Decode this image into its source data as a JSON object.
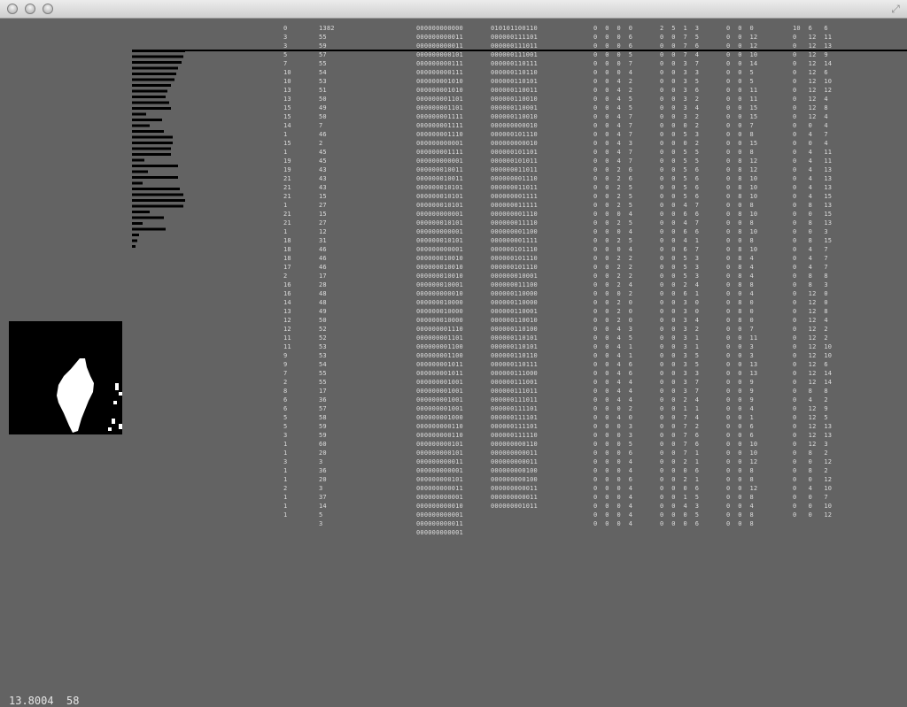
{
  "window": {
    "title": ""
  },
  "col_a": [
    "0",
    "3",
    "3",
    "5",
    "7",
    "10",
    "10",
    "13",
    "13",
    "15",
    "15",
    "14",
    "1",
    "15",
    "1",
    "19",
    "19",
    "21",
    "21",
    "21",
    "1",
    "21",
    "21",
    "1",
    "18",
    "18",
    "18",
    "17",
    "2",
    "16",
    "16",
    "14",
    "13",
    "12",
    "12",
    "11",
    "11",
    "9",
    "9",
    "7",
    "2",
    "8",
    "6",
    "6",
    "5",
    "5",
    "3",
    "1",
    "1",
    "3",
    "1",
    "1",
    "2",
    "1",
    "1",
    "1"
  ],
  "col_b": [
    "1382",
    "55",
    "59",
    "57",
    "55",
    "54",
    "53",
    "51",
    "50",
    "49",
    "50",
    "7",
    "46",
    "2",
    "45",
    "45",
    "43",
    "43",
    "43",
    "15",
    "27",
    "15",
    "27",
    "12",
    "31",
    "46",
    "46",
    "46",
    "17",
    "28",
    "48",
    "48",
    "49",
    "50",
    "52",
    "52",
    "53",
    "53",
    "54",
    "55",
    "55",
    "17",
    "36",
    "57",
    "58",
    "59",
    "59",
    "60",
    "20",
    "3",
    "36",
    "20",
    "3",
    "37",
    "14",
    "5",
    "3"
  ],
  "col_c": [
    "000000000000",
    "000000000011",
    "000000000011",
    "000000000101",
    "000000000111",
    "000000000111",
    "000000001010",
    "000000001010",
    "000000001101",
    "000000001101",
    "000000001111",
    "000000001111",
    "000000001110",
    "000000000001",
    "000000001111",
    "000000000001",
    "000000010011",
    "000000010011",
    "000000010101",
    "000000010101",
    "000000010101",
    "000000000001",
    "000000010101",
    "000000000001",
    "000000010101",
    "000000000001",
    "000000010010",
    "000000010010",
    "000000010010",
    "000000010001",
    "000000000010",
    "000000010000",
    "000000010000",
    "000000010000",
    "000000001110",
    "000000001101",
    "000000001100",
    "000000001100",
    "000000001011",
    "000000001011",
    "000000001001",
    "000000001001",
    "000000001001",
    "000000001001",
    "000000001000",
    "000000000110",
    "000000000110",
    "000000000101",
    "000000000101",
    "000000000011",
    "000000000001",
    "000000000101",
    "000000000011",
    "000000000001",
    "000000000010",
    "000000000001",
    "000000000011",
    "000000000001"
  ],
  "col_d": [
    "010101100110",
    "000000111101",
    "000000111011",
    "000000111001",
    "000000110111",
    "000000110110",
    "000000110101",
    "000000110011",
    "000000110010",
    "000000110001",
    "000000110010",
    "000000000010",
    "000000101110",
    "000000000010",
    "000000101101",
    "000000101011",
    "000000011011",
    "000000001110",
    "000000011011",
    "000000001111",
    "000000011111",
    "000000001110",
    "000000011110",
    "000000001100",
    "000000001111",
    "000000101110",
    "000000101110",
    "000000101110",
    "000000010001",
    "000000011100",
    "000000110000",
    "000000110000",
    "000000110001",
    "000000110010",
    "000000110100",
    "000000110101",
    "000000110101",
    "000000110110",
    "000000110111",
    "000000111000",
    "000000111001",
    "000000111011",
    "000000111011",
    "000000111101",
    "000000111101",
    "000000111101",
    "000000111110",
    "000000000110",
    "000000000011",
    "000000000011",
    "000000000100",
    "000000000100",
    "000000000011",
    "000000000011",
    "000000001011"
  ],
  "col_e": [
    "0  0  0  0",
    "0  0  0  6",
    "0  0  0  6",
    "0  0  0  5",
    "0  0  0  7",
    "0  0  0  4",
    "0  0  4  2",
    "0  0  4  2",
    "0  0  4  5",
    "0  0  4  5",
    "0  0  4  7",
    "0  0  4  7",
    "0  0  4  7",
    "0  0  4  3",
    "0  0  4  7",
    "0  0  4  7",
    "0  0  2  6",
    "0  0  2  6",
    "0  0  2  5",
    "0  0  2  5",
    "0  0  2  5",
    "0  0  0  4",
    "0  0  2  5",
    "0  0  0  4",
    "0  0  2  5",
    "0  0  0  4",
    "0  0  2  2",
    "0  0  2  2",
    "0  0  2  2",
    "0  0  2  4",
    "0  0  0  2",
    "0  0  2  0",
    "0  0  2  0",
    "0  0  2  0",
    "0  0  4  3",
    "0  0  4  5",
    "0  0  4  1",
    "0  0  4  1",
    "0  0  4  6",
    "0  0  4  6",
    "0  0  4  4",
    "0  0  4  4",
    "0  0  4  4",
    "0  0  0  2",
    "0  0  4  0",
    "0  0  0  3",
    "0  0  0  3",
    "0  0  0  5",
    "0  0  0  6",
    "0  0  0  4",
    "0  0  0  4",
    "0  0  0  6",
    "0  0  0  4",
    "0  0  0  4",
    "0  0  0  4",
    "0  0  0  4",
    "0  0  0  4"
  ],
  "col_f": [
    "2  5  1  3",
    "0  0  7  5",
    "0  0  7  6",
    "0  0  7  4",
    "0  0  3  7",
    "0  0  3  3",
    "0  0  3  5",
    "0  0  3  6",
    "0  0  3  2",
    "0  0  3  4",
    "0  0  3  2",
    "0  0  0  2",
    "0  0  5  3",
    "0  0  0  2",
    "0  0  5  5",
    "0  0  5  5",
    "0  0  5  6",
    "0  0  5  6",
    "0  0  5  6",
    "0  0  5  6",
    "0  0  4  7",
    "0  0  6  6",
    "0  0  4  7",
    "0  0  6  6",
    "0  0  4  1",
    "0  0  6  7",
    "0  0  5  3",
    "0  0  5  3",
    "0  0  5  3",
    "0  0  2  4",
    "0  0  6  1",
    "0  0  3  0",
    "0  0  3  0",
    "0  0  3  4",
    "0  0  3  2",
    "0  0  3  1",
    "0  0  3  1",
    "0  0  3  5",
    "0  0  3  5",
    "0  0  3  3",
    "0  0  3  7",
    "0  0  3  7",
    "0  0  2  4",
    "0  0  1  1",
    "0  0  7  4",
    "0  0  7  2",
    "0  0  7  6",
    "0  0  7  6",
    "0  0  7  1",
    "0  0  2  1",
    "0  0  0  6",
    "0  0  2  1",
    "0  0  0  6",
    "0  0  1  5",
    "0  0  4  3",
    "0  0  0  5",
    "0  0  0  6"
  ],
  "col_g": [
    "0  0  0",
    "0  0  12",
    "0  0  12",
    "0  0  10",
    "0  0  14",
    "0  0  5",
    "0  0  5",
    "0  0  11",
    "0  0  11",
    "0  0  15",
    "0  0  15",
    "0  0  7",
    "0  0  8",
    "0  0  15",
    "0  0  8",
    "0  8  12",
    "0  8  12",
    "0  8  10",
    "0  8  10",
    "0  8  10",
    "0  0  8",
    "0  8  10",
    "0  0  8",
    "0  8  10",
    "0  0  8",
    "0  8  10",
    "0  8  4",
    "0  8  4",
    "0  8  4",
    "0  8  8",
    "0  0  4",
    "0  8  0",
    "0  8  0",
    "0  8  0",
    "0  0  7",
    "0  0  11",
    "0  0  3",
    "0  0  3",
    "0  0  13",
    "0  0  13",
    "0  0  9",
    "0  0  9",
    "0  0  9",
    "0  0  4",
    "0  0  1",
    "0  0  6",
    "0  0  6",
    "0  0  10",
    "0  0  10",
    "0  0  12",
    "0  0  8",
    "0  0  8",
    "0  0  12",
    "0  0  8",
    "0  0  4",
    "0  0  8",
    "0  0  8"
  ],
  "col_h": [
    "10  6   6",
    "0   12  11",
    "0   12  13",
    "0   12  9",
    "0   12  14",
    "0   12  6",
    "0   12  10",
    "0   12  12",
    "0   12  4",
    "0   12  8",
    "0   12  4",
    "0   0   4",
    "0   4   7",
    "0   0   4",
    "0   4   11",
    "0   4   11",
    "0   4   13",
    "0   4   13",
    "0   4   13",
    "0   4   15",
    "0   8   13",
    "0   0   15",
    "0   8   13",
    "0   0   3",
    "0   8   15",
    "0   4   7",
    "0   4   7",
    "0   4   7",
    "0   8   8",
    "0   8   3",
    "0   12  0",
    "0   12  0",
    "0   12  8",
    "0   12  4",
    "0   12  2",
    "0   12  2",
    "0   12  10",
    "0   12  10",
    "0   12  6",
    "0   12  14",
    "0   12  14",
    "0   8   8",
    "0   4   2",
    "0   12  9",
    "0   12  5",
    "0   12  13",
    "0   12  13",
    "0   12  3",
    "0   8   2",
    "0   0   12",
    "0   8   2",
    "0   0   12",
    "0   4   10",
    "0   0   7",
    "0   0   10",
    "0   0   12"
  ],
  "bar_lengths": [
    60,
    58,
    56,
    52,
    50,
    48,
    44,
    40,
    38,
    42,
    44,
    16,
    34,
    20,
    36,
    46,
    46,
    44,
    44,
    14,
    52,
    18,
    52,
    12,
    54,
    58,
    60,
    58,
    20,
    36,
    12,
    38,
    8,
    6,
    4
  ],
  "status": {
    "fps": "13.8004",
    "frame": "58"
  }
}
